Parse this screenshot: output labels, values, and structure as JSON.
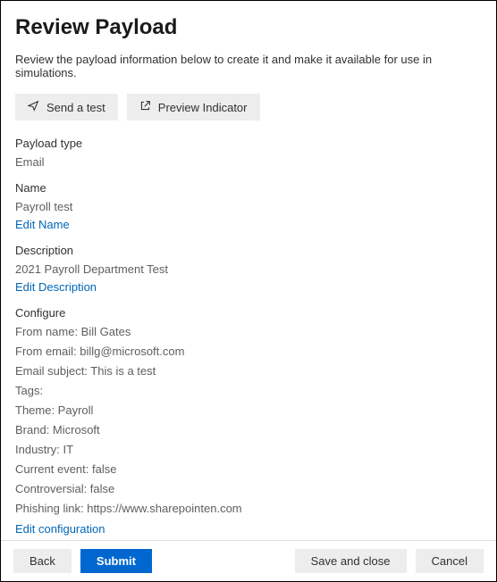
{
  "header": {
    "title": "Review Payload",
    "description": "Review the payload information below to create it and make it available for use in simulations."
  },
  "actions": {
    "send_test": "Send a test",
    "preview_indicator": "Preview Indicator"
  },
  "payload_type": {
    "label": "Payload type",
    "value": "Email"
  },
  "name": {
    "label": "Name",
    "value": "Payroll test",
    "edit_link": "Edit Name"
  },
  "description_section": {
    "label": "Description",
    "value": "2021 Payroll Department Test",
    "edit_link": "Edit Description"
  },
  "configure": {
    "label": "Configure",
    "items": [
      "From name: Bill Gates",
      "From email: billg@microsoft.com",
      "Email subject: This is a test",
      "Tags:",
      "Theme: Payroll",
      "Brand: Microsoft",
      "Industry: IT",
      "Current event: false",
      "Controversial: false",
      "Phishing link: https://www.sharepointen.com"
    ],
    "edit_link": "Edit configuration"
  },
  "footer": {
    "back": "Back",
    "submit": "Submit",
    "save_close": "Save and close",
    "cancel": "Cancel"
  }
}
